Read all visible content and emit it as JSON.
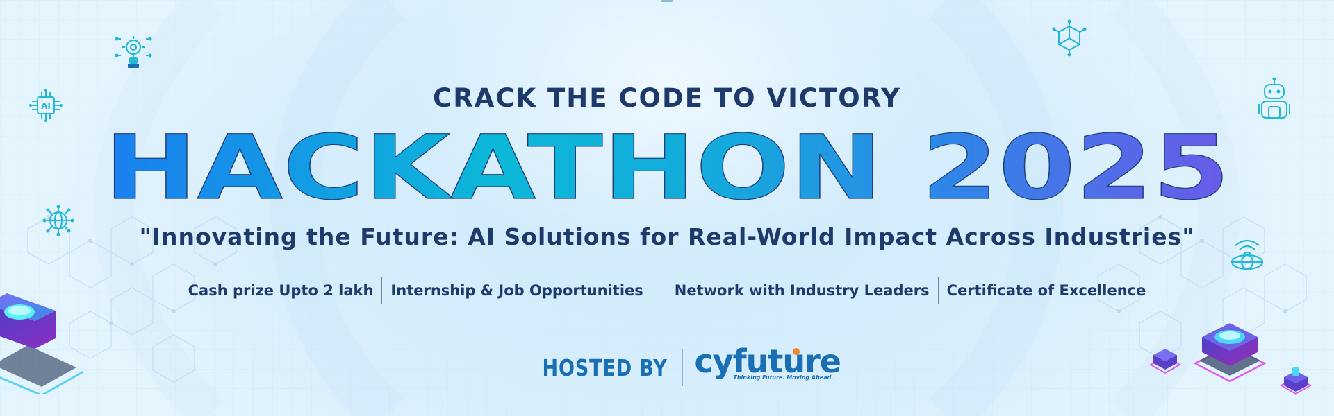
{
  "banner": {
    "headline": "CRACK THE CODE TO VICTORY",
    "title": "HACKATHON 2025",
    "tagline": "\"Innovating the Future: AI Solutions for Real-World Impact Across Industries\"",
    "features": [
      "Cash prize Upto 2 lakh",
      "Internship & Job Opportunities",
      "Network with Industry Leaders",
      "Certificate of Excellence"
    ],
    "hosted_by": "HOSTED BY",
    "brand": {
      "name": "cyfuture",
      "tagline": "Thinking Future. Moving Ahead."
    },
    "colors": {
      "title_gradient_start": "#1a7ff0",
      "title_gradient_mid": "#0cb4d6",
      "title_gradient_end": "#6a5ae8",
      "text_dark": "#1d3a6b",
      "brand_blue": "#1a6fb4",
      "icon_teal": "#27b7d6"
    },
    "icons": [
      "gear-hand-icon",
      "ai-chip-icon",
      "globe-network-icon",
      "molecule-cube-icon",
      "robot-icon",
      "wifi-globe-icon"
    ]
  }
}
